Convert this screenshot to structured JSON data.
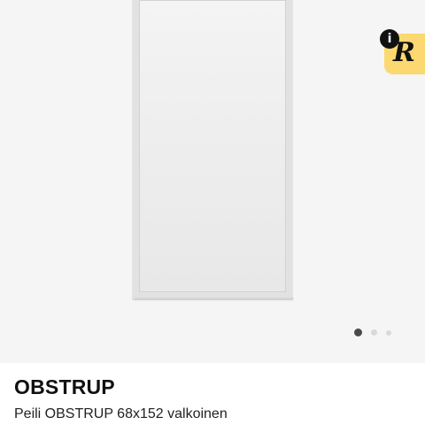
{
  "product": {
    "name": "OBSTRUP",
    "description": "Peili OBSTRUP 68x152 valkoinen"
  },
  "badge": {
    "letter": "R",
    "info_glyph": "i",
    "color": "#fbd970"
  },
  "carousel": {
    "total_images": 3,
    "active_index": 0
  },
  "colors": {
    "image_background": "#f5f5f5",
    "frame": "#e2e2e2",
    "active_dot": "#4a4a4a",
    "inactive_dot": "#d9d9d9"
  }
}
